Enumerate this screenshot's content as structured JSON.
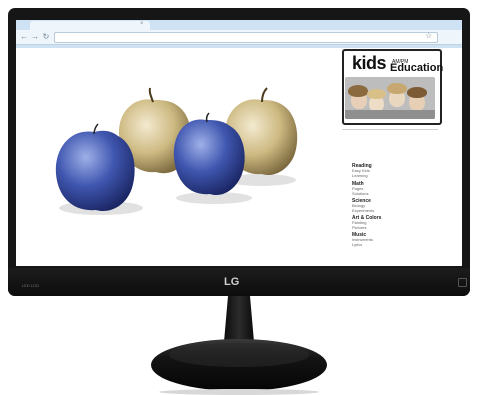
{
  "monitor": {
    "brand": "LG",
    "bezel_label": "LED LCD"
  },
  "browser": {
    "back_icon": "back-arrow-icon",
    "forward_icon": "forward-arrow-icon",
    "reload_icon": "reload-icon",
    "star_icon": "star-icon",
    "tab_close_icon": "close-icon"
  },
  "logo": {
    "kids": "kids",
    "ampm": "AM/PM",
    "education": "Education"
  },
  "menu": [
    {
      "title": "Reading",
      "items": [
        "Easy Kids",
        "Learning"
      ]
    },
    {
      "title": "Math",
      "items": [
        "Pages",
        "Solutions"
      ]
    },
    {
      "title": "Science",
      "items": [
        "Biology",
        "Experiments"
      ]
    },
    {
      "title": "Art & Colors",
      "items": [
        "Painting",
        "Pictures"
      ]
    },
    {
      "title": "Music",
      "items": [
        "Instruments",
        "Lyrics"
      ]
    }
  ],
  "colors": {
    "bezel": "#161616",
    "browser_chrome": "#cfe2f3",
    "apple_blue": "#3d52a8",
    "apple_gold": "#c8b47a"
  }
}
